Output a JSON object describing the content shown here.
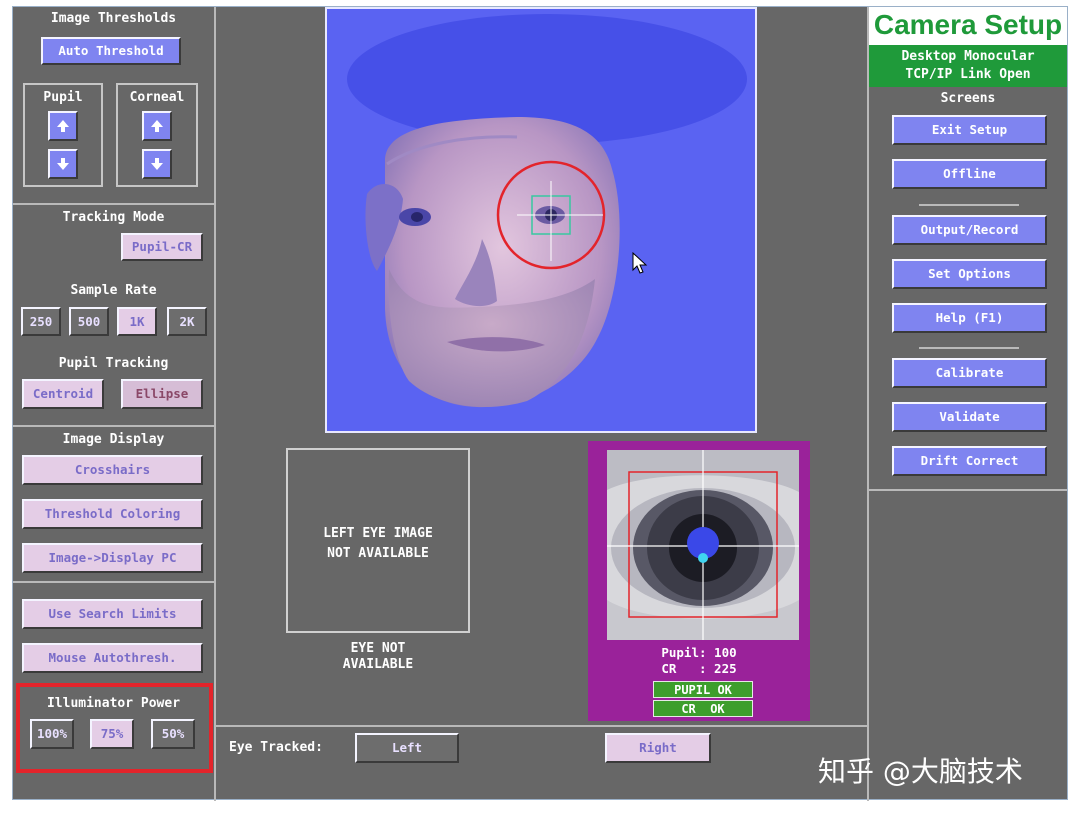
{
  "left_panel": {
    "thresholds_title": "Image Thresholds",
    "auto_threshold": "Auto Threshold",
    "pupil_label": "Pupil",
    "corneal_label": "Corneal",
    "tracking_mode_title": "Tracking Mode",
    "tracking_mode_value": "Pupil-CR",
    "sample_rate_title": "Sample Rate",
    "sample_rates": [
      "250",
      "500",
      "1K",
      "2K"
    ],
    "pupil_tracking_title": "Pupil Tracking",
    "centroid": "Centroid",
    "ellipse": "Ellipse",
    "image_display_title": "Image Display",
    "crosshairs": "Crosshairs",
    "threshold_coloring": "Threshold Coloring",
    "image_display_pc": "Image->Display PC",
    "use_search_limits": "Use Search Limits",
    "mouse_autothresh": "Mouse Autothresh.",
    "illuminator_title": "Illuminator Power",
    "illuminator_levels": [
      "100%",
      "75%",
      "50%"
    ]
  },
  "center": {
    "left_eye_line1": "LEFT EYE IMAGE",
    "left_eye_line2": "NOT AVAILABLE",
    "eye_not_line1": "EYE NOT",
    "eye_not_line2": "AVAILABLE",
    "pupil_value": "Pupil: 100",
    "cr_value": "CR   : 225",
    "pupil_ok": "PUPIL OK",
    "cr_ok": "CR  OK",
    "eye_tracked_label": "Eye Tracked:",
    "left_button": "Left",
    "right_button": "Right"
  },
  "right_panel": {
    "title": "Camera Setup",
    "mode_line1": "Desktop Monocular",
    "mode_line2": "TCP/IP Link Open",
    "screens_title": "Screens",
    "exit_setup": "Exit Setup",
    "offline": "Offline",
    "output_record": "Output/Record",
    "set_options": "Set Options",
    "help": "Help (F1)",
    "calibrate": "Calibrate",
    "validate": "Validate",
    "drift_correct": "Drift Correct"
  },
  "watermark": "知乎 @大脑技术",
  "colors": {
    "background": "#676767",
    "button_blue": "#7f84f0",
    "button_pink": "#e4cde6",
    "camera_bg": "#5a63f2",
    "eye_panel": "#9a229a",
    "header_green": "#1f9a3a",
    "highlight_red": "#e3242b"
  }
}
